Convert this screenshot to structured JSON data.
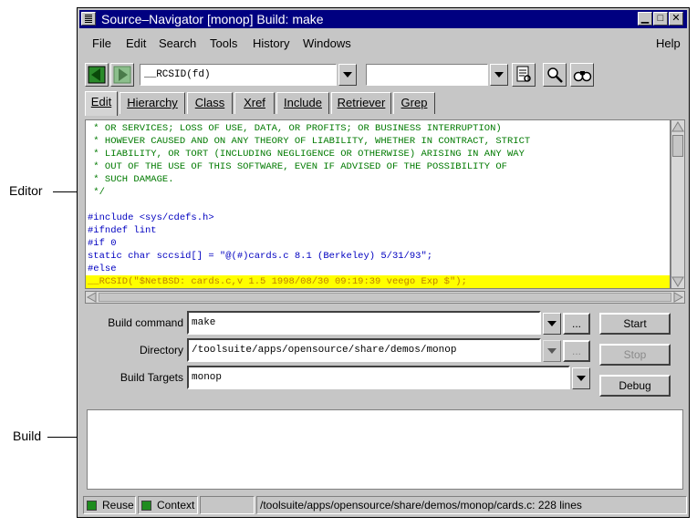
{
  "callouts": {
    "editor": "Editor",
    "build": "Build"
  },
  "window": {
    "title": "Source–Navigator [monop] Build: make",
    "minimize": "▁",
    "maximize": "□",
    "close": "✕"
  },
  "menu": {
    "file": "File",
    "edit": "Edit",
    "search": "Search",
    "tools": "Tools",
    "history": "History",
    "windows": "Windows",
    "help": "Help"
  },
  "toolbar": {
    "symbol_value": "__RCSID(fd)",
    "second_value": ""
  },
  "tabs": [
    "Edit",
    "Hierarchy",
    "Class",
    "Xref",
    "Include",
    "Retriever",
    "Grep"
  ],
  "editor": {
    "lines": [
      " * OR SERVICES; LOSS OF USE, DATA, OR PROFITS; OR BUSINESS INTERRUPTION)",
      " * HOWEVER CAUSED AND ON ANY THEORY OF LIABILITY, WHETHER IN CONTRACT, STRICT",
      " * LIABILITY, OR TORT (INCLUDING NEGLIGENCE OR OTHERWISE) ARISING IN ANY WAY",
      " * OUT OF THE USE OF THIS SOFTWARE, EVEN IF ADVISED OF THE POSSIBILITY OF",
      " * SUCH DAMAGE.",
      " */",
      "",
      "#include <sys/cdefs.h>",
      "#ifndef lint",
      "#if 0",
      "static char sccsid[] = \"@(#)cards.c 8.1 (Berkeley) 5/31/93\";",
      "#else",
      "__RCSID(\"$NetBSD: cards.c,v 1.5 1998/08/30 09:19:39 veego Exp $\");"
    ]
  },
  "build": {
    "command_label": "Build command",
    "command_value": "make",
    "directory_label": "Directory",
    "directory_value": "/toolsuite/apps/opensource/share/demos/monop",
    "targets_label": "Build Targets",
    "targets_value": "monop",
    "ellipsis": "...",
    "start": "Start",
    "stop": "Stop",
    "debug": "Debug"
  },
  "status": {
    "reuse": "Reuse",
    "context": "Context",
    "empty": "",
    "path": "/toolsuite/apps/opensource/share/demos/monop/cards.c: 228 lines"
  },
  "colors": {
    "titlebar": "#000080",
    "comment": "#007a00",
    "preprocessor": "#0000c0",
    "string": "#8b5a00",
    "highlight": "#ffff00"
  }
}
